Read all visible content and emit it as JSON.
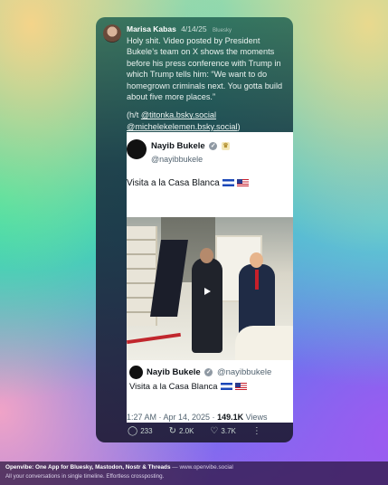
{
  "post": {
    "author": "Marisa Kabas",
    "date": "4/14/25",
    "platform": "Bluesky",
    "paragraph1": "Holy shit. Video posted by President Bukele’s team on X shows the moments before his press conference with Trump in which Trump tells him: “We want to do homegrown criminals next. You gotta build about five more places.”",
    "ht_prefix": "(h/t ",
    "ht_link1": "@titonka.bsky.social",
    "ht_link2": "@michelekelemen.bsky.social",
    "ht_suffix": ")"
  },
  "embed": {
    "name": "Nayib Bukele",
    "handle": "@nayibbukele",
    "text": "Visita a la Casa Blanca",
    "quote_name": "Nayib Bukele",
    "quote_handle": "@nayibbukele",
    "quote_text": "Visita a la Casa Blanca",
    "time": "1:27 AM · Apr 14, 2025 · ",
    "views_count": "149.1K",
    "views_label": " Views"
  },
  "actions": {
    "replies": "233",
    "reposts": "2.0K",
    "likes": "3.7K"
  },
  "footer": {
    "line1_bold": "Openvibe: One App for Bluesky, Mastodon, Nostr & Threads",
    "line1_url": " — www.openvibe.social",
    "line2": "All your conversations in single timeline. Effortless crossposting."
  },
  "icons": [
    "verified-icon",
    "crown-icon",
    "flag-sv-icon",
    "flag-us-icon",
    "play-icon",
    "reply-icon",
    "repost-icon",
    "like-icon",
    "more-icon"
  ]
}
